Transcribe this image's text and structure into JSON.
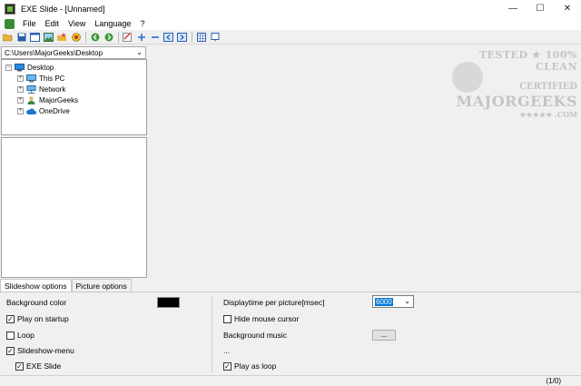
{
  "window": {
    "title": "EXE Slide - [Unnamed]",
    "controls": {
      "minimize": "—",
      "maximize": "☐",
      "close": "✕"
    }
  },
  "menu": [
    "File",
    "Edit",
    "View",
    "Language",
    "?"
  ],
  "toolbar": {
    "icons": [
      "open-folder-icon",
      "save-icon",
      "window-icon",
      "image-icon",
      "folder-star-icon",
      "record-icon",
      "nav-back-icon",
      "nav-forward-icon",
      "image-edit-icon",
      "add-icon",
      "remove-icon",
      "move-left-icon",
      "move-right-icon",
      "grid-icon",
      "help-icon"
    ]
  },
  "path": {
    "value": "C:\\Users\\MajorGeeks\\Desktop"
  },
  "tree": [
    {
      "label": "Desktop",
      "icon": "desktop-icon",
      "level": 0,
      "expander": "−"
    },
    {
      "label": "This PC",
      "icon": "computer-icon",
      "level": 1,
      "expander": "+"
    },
    {
      "label": "Network",
      "icon": "network-icon",
      "level": 1,
      "expander": "+"
    },
    {
      "label": "MajorGeeks",
      "icon": "user-icon",
      "level": 1,
      "expander": "+"
    },
    {
      "label": "OneDrive",
      "icon": "cloud-icon",
      "level": 1,
      "expander": "+"
    }
  ],
  "watermark": {
    "line1": "TESTED ★ 100% CLEAN",
    "line2": "CERTIFIED",
    "line3": "MAJORGEEKS",
    "stars": "★★★★★ .COM"
  },
  "tabs": [
    "Slideshow options",
    "Picture options"
  ],
  "options": {
    "background_color_label": "Background color",
    "background_color": "#000000",
    "play_on_startup": {
      "label": "Play on startup",
      "checked": true
    },
    "loop": {
      "label": "Loop",
      "checked": false
    },
    "slideshow_menu": {
      "label": "Slideshow-menu",
      "checked": true
    },
    "exe_slide": {
      "label": "EXE Slide",
      "checked": true
    },
    "displaytime_label": "Displaytime per picture[msec]",
    "displaytime_value": "6000",
    "hide_mouse": {
      "label": "Hide mouse cursor",
      "checked": false
    },
    "background_music_label": "Background music",
    "music_button": "...",
    "music_path": "...",
    "play_as_loop": {
      "label": "Play as loop",
      "checked": true
    }
  },
  "status": {
    "text": "(1/0)"
  }
}
